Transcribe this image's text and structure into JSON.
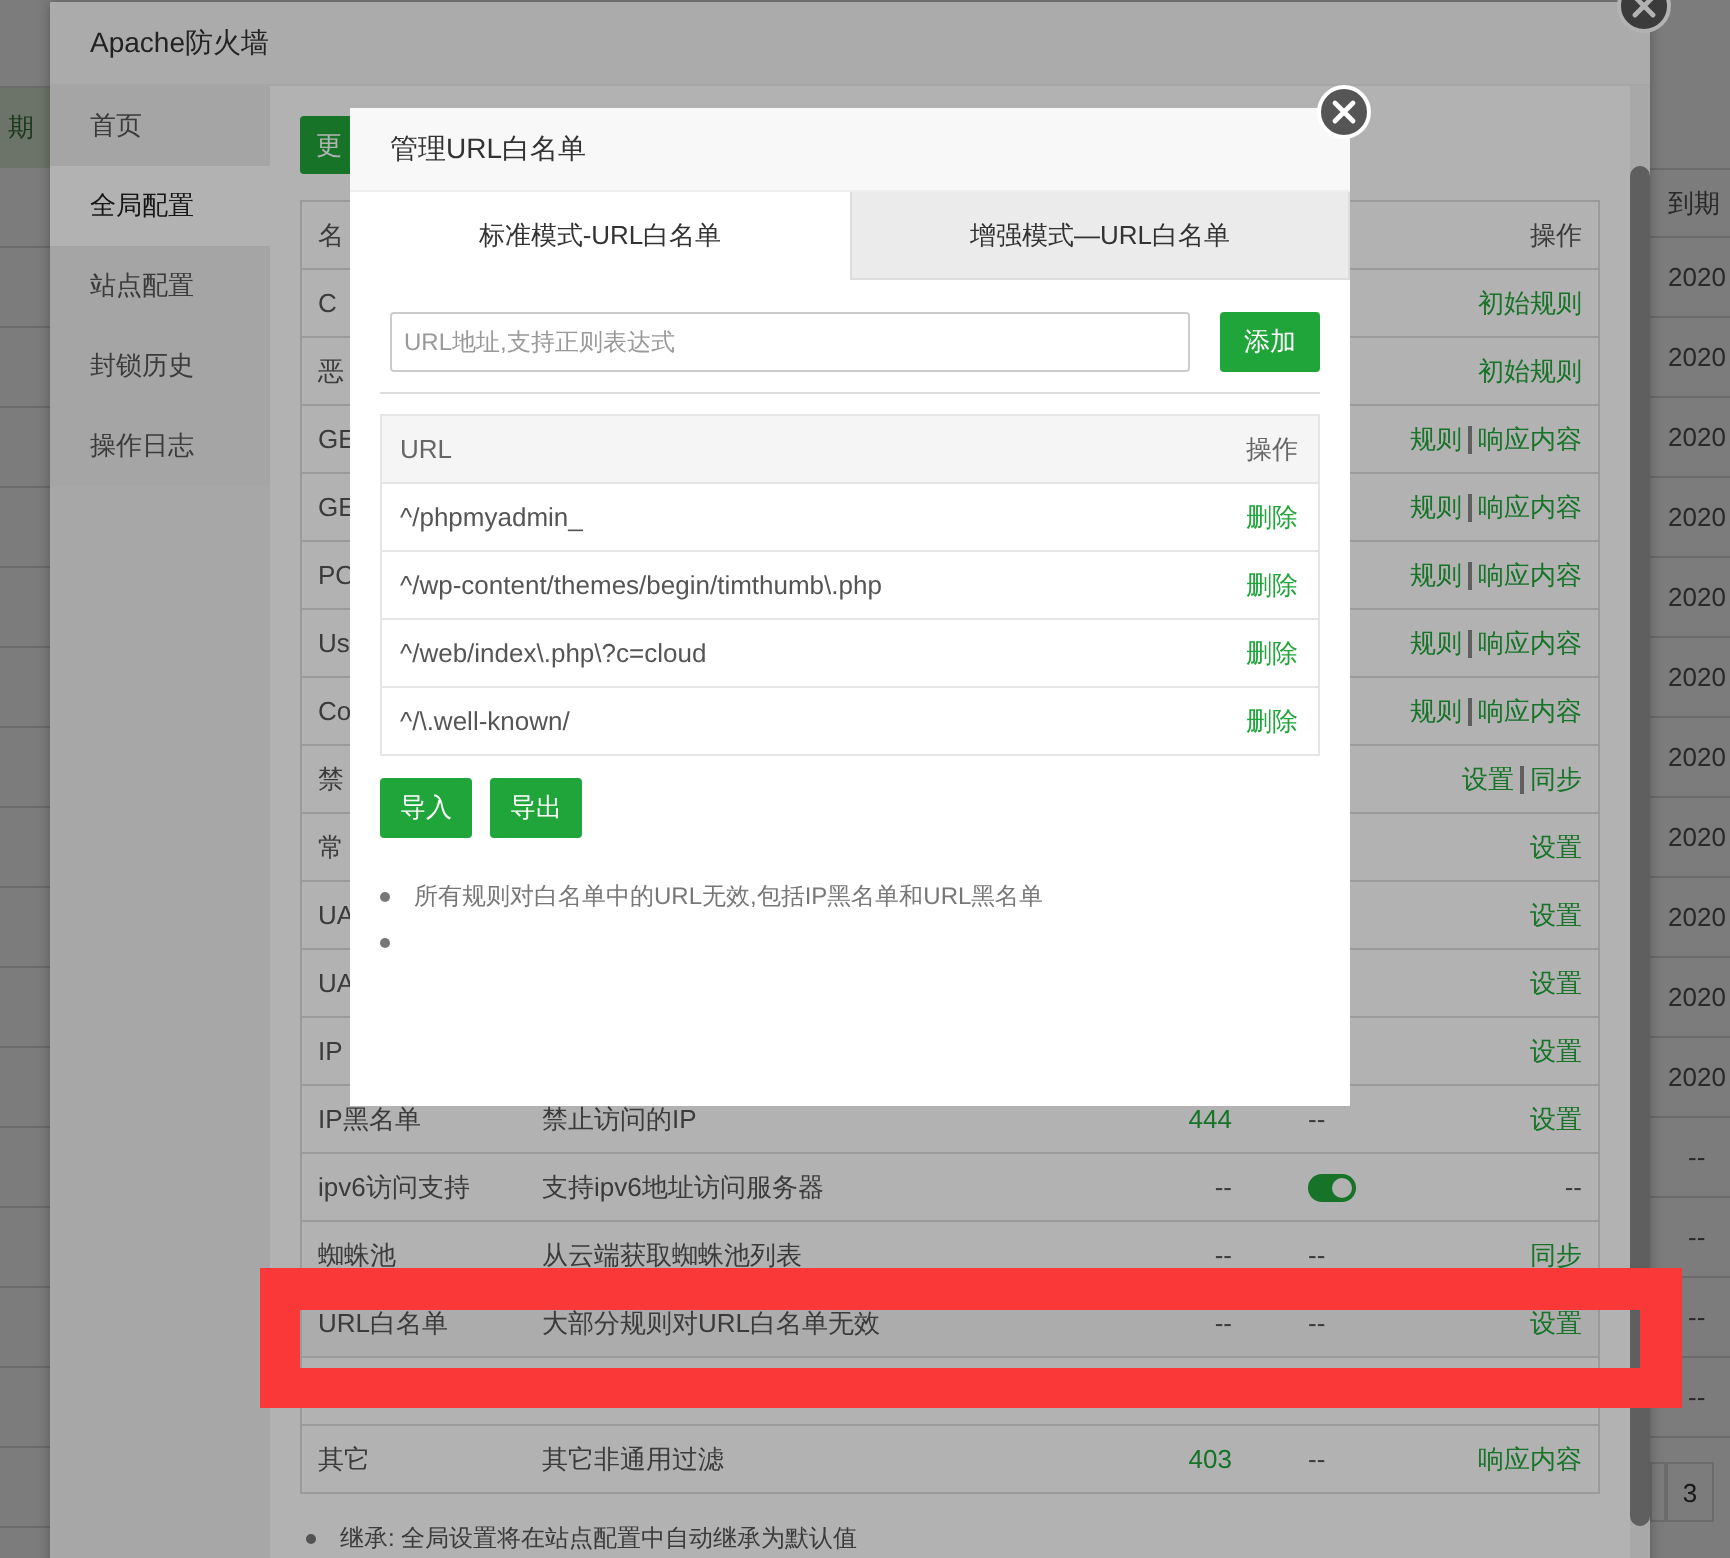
{
  "page": {
    "left_fragment": "期",
    "column_header": "到期",
    "dates": [
      "2020",
      "2020",
      "2020",
      "2020",
      "2020",
      "2020",
      "2020",
      "2020",
      "2020",
      "2020",
      "2020"
    ],
    "dashes": [
      "--",
      "--",
      "--",
      "--"
    ],
    "pagination_page": "3"
  },
  "window": {
    "title": "Apache防火墙",
    "sidebar": [
      {
        "label": "首页",
        "selected": false
      },
      {
        "label": "全局配置",
        "selected": true
      },
      {
        "label": "站点配置",
        "selected": false
      },
      {
        "label": "封锁历史",
        "selected": false
      },
      {
        "label": "操作日志",
        "selected": false
      }
    ],
    "toolbar_button": "更",
    "table": {
      "columns": [
        "名",
        "操作"
      ],
      "rows": [
        {
          "name": "C",
          "actions": [
            "初始规则"
          ]
        },
        {
          "name": "恶",
          "actions": [
            "初始规则"
          ]
        },
        {
          "name": "GE",
          "actions": [
            "规则",
            "响应内容"
          ]
        },
        {
          "name": "GE",
          "actions": [
            "规则",
            "响应内容"
          ]
        },
        {
          "name": "PO",
          "actions": [
            "规则",
            "响应内容"
          ]
        },
        {
          "name": "Us",
          "actions": [
            "规则",
            "响应内容"
          ]
        },
        {
          "name": "Co",
          "actions": [
            "规则",
            "响应内容"
          ]
        },
        {
          "name": "禁",
          "actions": [
            "设置",
            "同步"
          ]
        },
        {
          "name": "常",
          "actions": [
            "设置"
          ]
        },
        {
          "name": "UA",
          "actions": [
            "设置"
          ]
        },
        {
          "name": "UA",
          "actions": [
            "设置"
          ]
        },
        {
          "name": "IP",
          "actions": [
            "设置"
          ]
        },
        {
          "name": "IP黑名单",
          "description": "禁止访问的IP",
          "count": "444",
          "status": "--",
          "actions": [
            "设置"
          ]
        },
        {
          "name": "ipv6访问支持",
          "description": "支持ipv6地址访问服务器",
          "count": "--",
          "toggle": {
            "on": true
          },
          "actions": [
            "--"
          ]
        },
        {
          "name": "蜘蛛池",
          "description": "从云端获取蜘蛛池列表",
          "count": "--",
          "status": "--",
          "actions": [
            "同步"
          ]
        },
        {
          "name": "URL白名单",
          "description": "大部分规则对URL白名单无效",
          "count": "--",
          "status": "--",
          "actions": [
            "设置"
          ],
          "highlighted": true
        },
        {},
        {
          "name": "其它",
          "description": "其它非通用过滤",
          "count": "403",
          "status": "--",
          "actions": [
            "响应内容"
          ]
        }
      ]
    },
    "notes": [
      "继承: 全局设置将在站点配置中自动继承为默认值"
    ]
  },
  "dialog": {
    "title": "管理URL白名单",
    "tabs": [
      {
        "label": "标准模式-URL白名单",
        "selected": true
      },
      {
        "label": "增强模式—URL白名单",
        "selected": false
      }
    ],
    "input": {
      "placeholder": "URL地址,支持正则表达式"
    },
    "add_button": "添加",
    "table": {
      "columns": [
        "URL",
        "操作"
      ],
      "rows": [
        {
          "url": "^/phpmyadmin_",
          "action": "删除"
        },
        {
          "url": "^/wp-content/themes/begin/timthumb\\.php",
          "action": "删除"
        },
        {
          "url": "^/web/index\\.php\\?c=cloud",
          "action": "删除"
        },
        {
          "url": "^/\\.well-known/",
          "action": "删除"
        }
      ]
    },
    "buttons": [
      "导入",
      "导出"
    ],
    "notes": [
      "所有规则对白名单中的URL无效,包括IP黑名单和URL黑名单"
    ],
    "trailing_empty_bullet": true
  }
}
